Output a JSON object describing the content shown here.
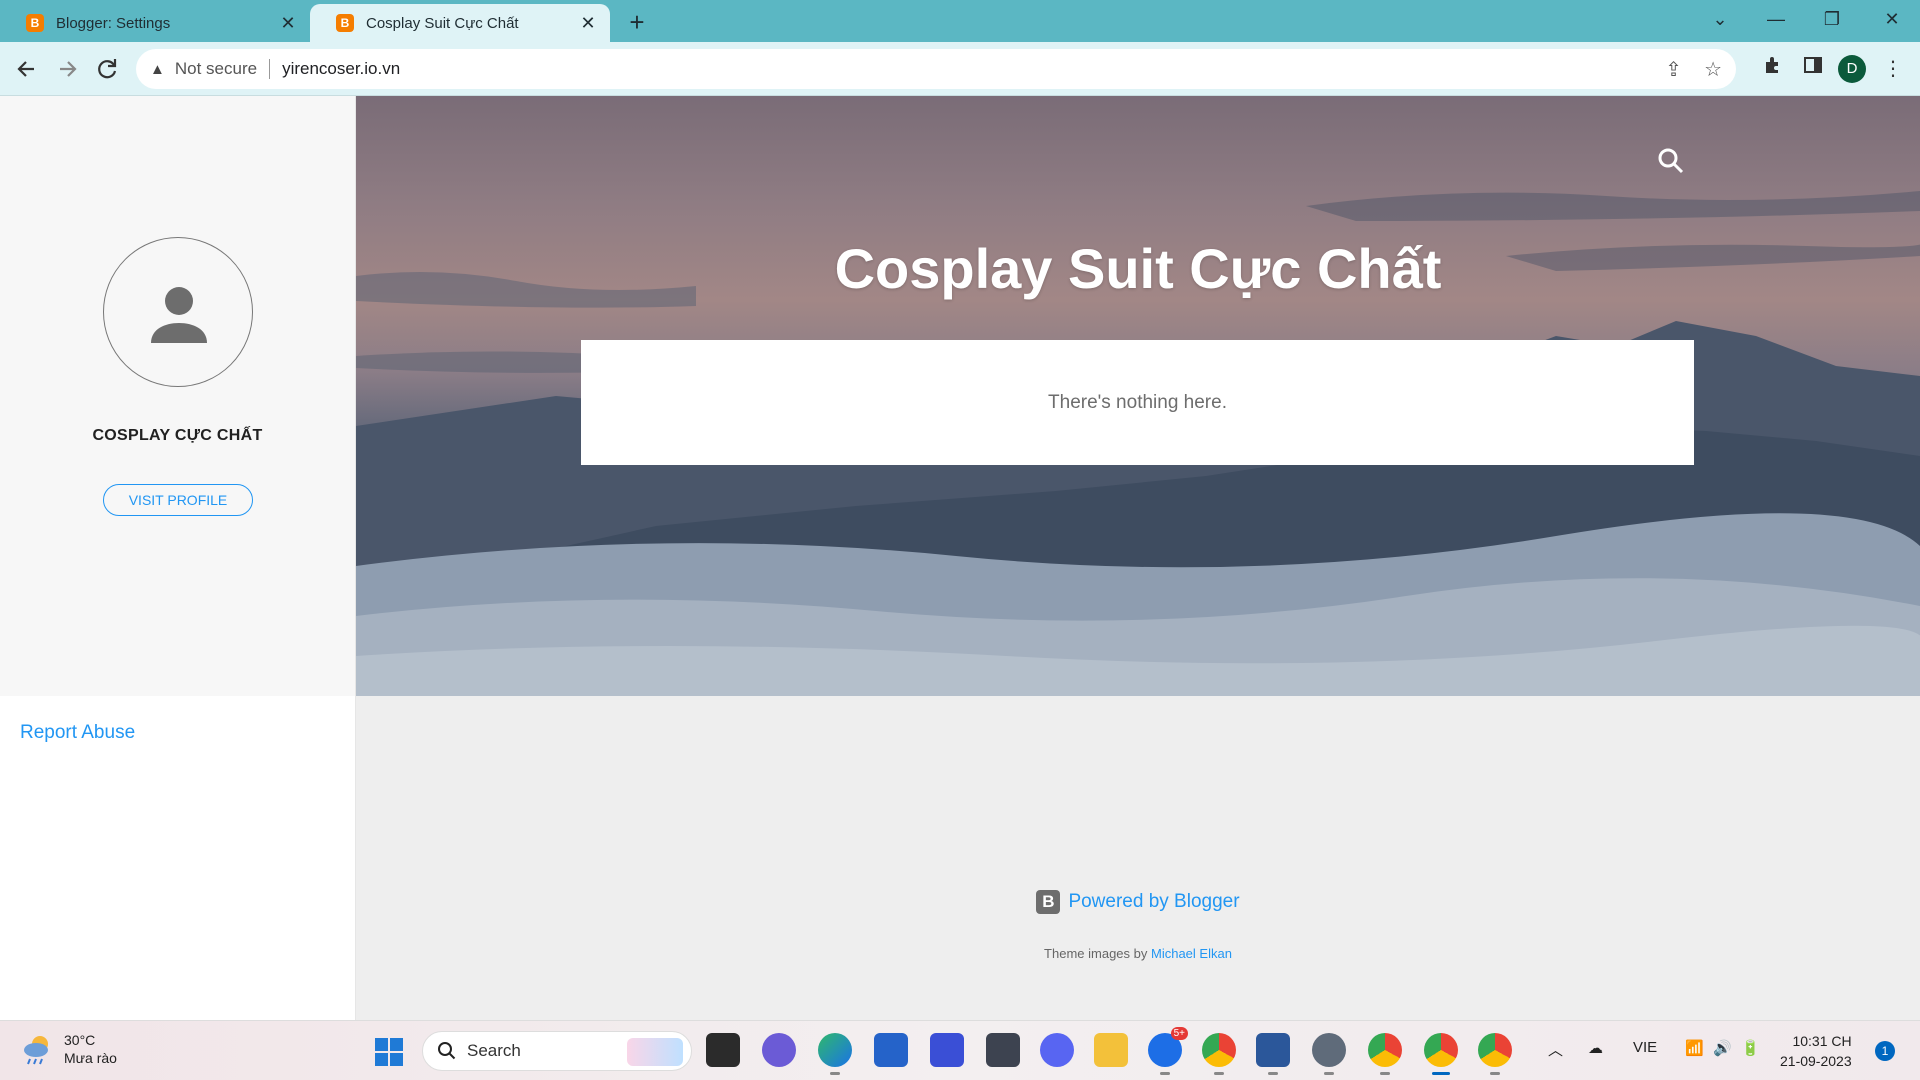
{
  "browser": {
    "tabs": [
      {
        "title": "Blogger: Settings",
        "active": false
      },
      {
        "title": "Cosplay Suit Cực Chất",
        "active": true
      }
    ],
    "new_tab_label": "+",
    "address_bar": {
      "security_label": "Not secure",
      "url": "yirencoser.io.vn"
    },
    "profile_initial": "D"
  },
  "blog": {
    "title": "Cosplay Suit Cực Chất",
    "empty_message": "There's nothing here.",
    "profile": {
      "name": "COSPLAY CỰC CHẤT",
      "visit_label": "VISIT PROFILE"
    },
    "report_abuse": "Report Abuse",
    "footer": {
      "powered_by": "Powered by Blogger",
      "theme_credit_prefix": "Theme images by",
      "theme_credit_author": "Michael Elkan"
    }
  },
  "taskbar": {
    "weather": {
      "temp": "30°C",
      "condition": "Mưa rào"
    },
    "search_label": "Search",
    "zalo_badge": "5+",
    "language": "VIE",
    "time": "10:31 CH",
    "date": "21-09-2023",
    "notification_count": "1"
  },
  "colors": {
    "tab_strip": "#5bb7c3",
    "toolbar": "#dff3f6",
    "link_blue": "#2196f3",
    "sidebar_bg": "#f7f7f7",
    "footer_bg": "#eeeeee"
  }
}
